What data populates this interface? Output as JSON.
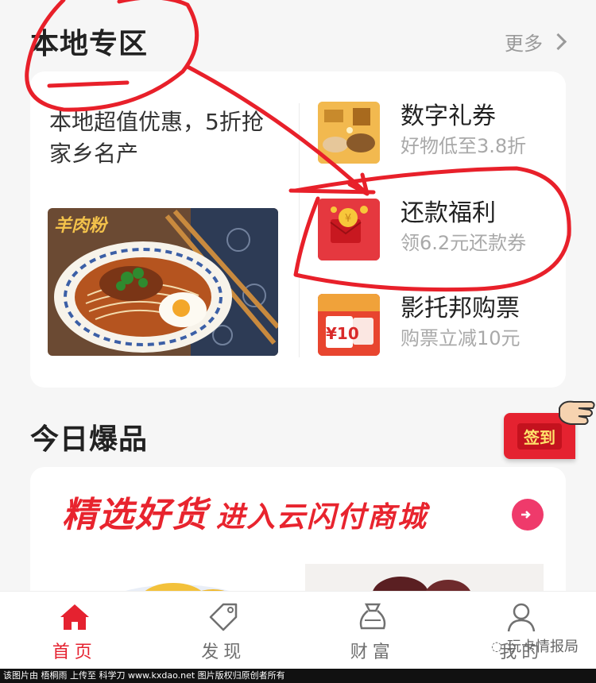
{
  "local_section": {
    "title": "本地专区",
    "more_label": "更多",
    "promo_text": "本地超值优惠，5折抢家乡名产",
    "food_caption": "羊肉粉",
    "offers": [
      {
        "title": "数字礼券",
        "subtitle": "好物低至3.8折",
        "icon": "gift-voucher-icon"
      },
      {
        "title": "还款福利",
        "subtitle": "领6.2元还款券",
        "icon": "red-envelope-icon"
      },
      {
        "title": "影托邦购票",
        "subtitle": "购票立减10元",
        "icon": "movie-ticket-icon",
        "badge": "¥10"
      }
    ]
  },
  "hot_section": {
    "title": "今日爆品",
    "banner_main": "精选好货",
    "banner_sub": "进入云闪付商城"
  },
  "signin": {
    "label": "签到"
  },
  "tabbar": {
    "items": [
      {
        "label": "首页",
        "icon": "home-icon",
        "active": true
      },
      {
        "label": "发现",
        "icon": "tag-icon",
        "active": false
      },
      {
        "label": "财富",
        "icon": "wallet-icon",
        "active": false
      },
      {
        "label": "我的",
        "icon": "user-icon",
        "active": false
      }
    ]
  },
  "watermark": {
    "text": "玩卡情报局"
  },
  "credit_bar": {
    "text": "该图片由 梧桐雨 上传至 科学刀 www.kxdao.net 图片版权归原创者所有"
  },
  "colors": {
    "accent": "#e52230",
    "annotation": "#e8202a",
    "muted": "#a9a9a9"
  }
}
